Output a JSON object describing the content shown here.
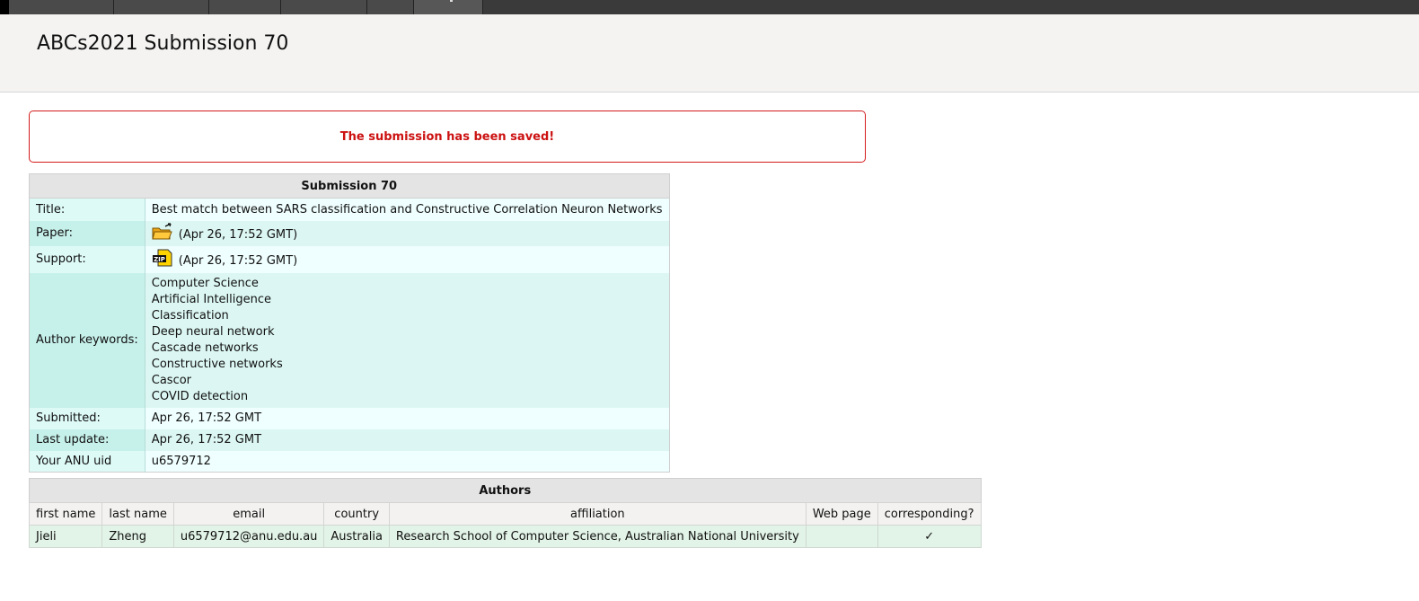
{
  "page": {
    "title": "ABCs2021 Submission 70"
  },
  "message": "The submission has been saved!",
  "submission": {
    "caption": "Submission 70",
    "title_label": "Title:",
    "title_value": "Best match between SARS classification and Constructive Correlation Neuron Networks",
    "paper_label": "Paper:",
    "paper_time": "(Apr 26, 17:52 GMT)",
    "paper_icon": "folder-open-icon",
    "support_label": "Support:",
    "support_time": "(Apr 26, 17:52 GMT)",
    "support_icon": "zip-file-icon",
    "keywords_label": "Author keywords:",
    "keywords": [
      "Computer Science",
      "Artificial Intelligence",
      "Classification",
      "Deep neural network",
      "Cascade networks",
      "Constructive networks",
      "Cascor",
      "COVID detection"
    ],
    "submitted_label": "Submitted:",
    "submitted_value": "Apr 26, 17:52 GMT",
    "last_update_label": "Last update:",
    "last_update_value": "Apr 26, 17:52 GMT",
    "uid_label": "Your ANU uid",
    "uid_value": "u6579712"
  },
  "authors": {
    "caption": "Authors",
    "columns": [
      "first name",
      "last name",
      "email",
      "country",
      "affiliation",
      "Web page",
      "corresponding?"
    ],
    "rows": [
      {
        "first_name": "Jieli",
        "last_name": "Zheng",
        "email": "u6579712@anu.edu.au",
        "country": "Australia",
        "affiliation": "Research School of Computer Science, Australian National University",
        "web_page": "",
        "corresponding": "✓"
      }
    ]
  },
  "colors": {
    "message_red": "#cc1111",
    "label_cell": "#c6f0ea",
    "author_row": "#e2f3e7"
  }
}
